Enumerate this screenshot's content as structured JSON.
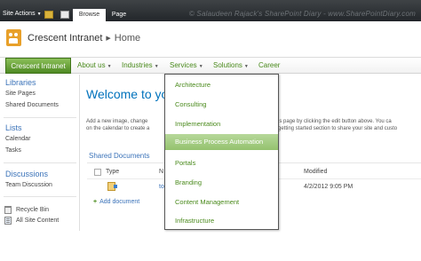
{
  "ribbon": {
    "site_actions": "Site Actions",
    "tabs": [
      "Browse",
      "Page"
    ],
    "watermark": "© Salaudeen Rajack's SharePoint Diary - www.SharePointDiary.com"
  },
  "site": {
    "title": "Crescent Intranet",
    "breadcrumb_current": "Home"
  },
  "topnav": {
    "home": "Crescent Intranet",
    "items": [
      "About us",
      "Industries",
      "Services",
      "Solutions",
      "Career"
    ]
  },
  "services_menu": {
    "options": [
      "Architecture",
      "Consulting",
      "Implementation",
      "Business Process Automation",
      "Portals",
      "Branding",
      "Content Management",
      "Infrastructure"
    ],
    "selected": "Business Process Automation"
  },
  "quick_launch": {
    "libraries": "Libraries",
    "libraries_items": [
      "Site Pages",
      "Shared Documents"
    ],
    "lists": "Lists",
    "lists_items": [
      "Calendar",
      "Tasks"
    ],
    "discussions": "Discussions",
    "discussions_items": [
      "Team Discussion"
    ],
    "recycle_bin": "Recycle Bin",
    "all_site_content": "All Site Content"
  },
  "main": {
    "welcome": "Welcome to yo",
    "desc_line1_left": "Add a new image, change",
    "desc_line2_left": "on the calendar to create a",
    "desc_line1_right": "is page by clicking the edit button above. You ca",
    "desc_line2_right": "getting started section to share your site and custo",
    "webpart_title": "Shared Documents",
    "columns": {
      "type": "Type",
      "name": "N",
      "modified": "Modified"
    },
    "row": {
      "name": "to",
      "modified": "4/2/2012 9:05 PM"
    },
    "add_document": "Add document"
  },
  "colors": {
    "link_green": "#4a8a1c",
    "link_blue": "#3b73b9",
    "heading_blue": "#0072bc",
    "selected_bg": "#a6cd85"
  }
}
